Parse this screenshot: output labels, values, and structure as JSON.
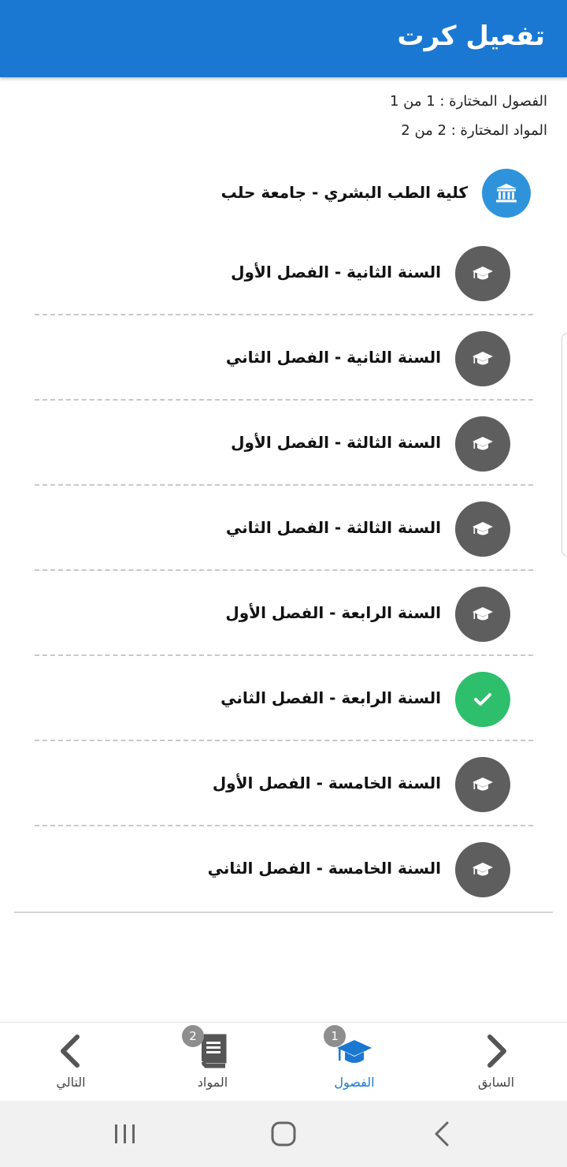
{
  "appbar": {
    "title": "تفعيل كرت",
    "color": "#1a78d2"
  },
  "summary": {
    "semesters": "الفصول المختارة : 1 من 1",
    "subjects": "المواد المختارة : 2 من 2"
  },
  "faculty": {
    "label": "كلية الطب البشري - جامعة حلب",
    "icon": "university-icon",
    "color": "#2f93dc"
  },
  "semesters": [
    {
      "label": "السنة الثانية - الفصل الأول",
      "selected": false
    },
    {
      "label": "السنة الثانية - الفصل الثاني",
      "selected": false
    },
    {
      "label": "السنة الثالثة - الفصل الأول",
      "selected": false
    },
    {
      "label": "السنة الثالثة - الفصل الثاني",
      "selected": false
    },
    {
      "label": "السنة الرابعة - الفصل الأول",
      "selected": false
    },
    {
      "label": "السنة الرابعة - الفصل الثاني",
      "selected": true
    },
    {
      "label": "السنة الخامسة - الفصل الأول",
      "selected": false
    },
    {
      "label": "السنة الخامسة - الفصل الثاني",
      "selected": false
    }
  ],
  "colors": {
    "unselected": "#5e5e5e",
    "selected": "#2dbf6c",
    "active_nav": "#1a78d2"
  },
  "bottom_nav": {
    "previous": {
      "label": "السابق",
      "icon": "chevron-right-icon"
    },
    "semesters": {
      "label": "الفصول",
      "icon": "graduation-cap-icon",
      "badge": "1"
    },
    "subjects": {
      "label": "المواد",
      "icon": "book-icon",
      "badge": "2"
    },
    "next": {
      "label": "التالي",
      "icon": "chevron-left-icon"
    }
  },
  "system_bar": {
    "icons": [
      "recent-apps-icon",
      "home-icon",
      "back-icon"
    ]
  }
}
